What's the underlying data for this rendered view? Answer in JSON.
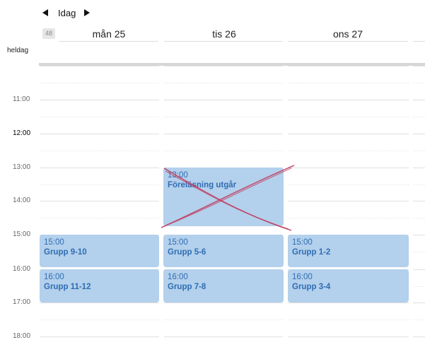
{
  "nav": {
    "today_label": "Idag"
  },
  "week_number": "48",
  "days": [
    "mån 25",
    "tis 26",
    "ons 27"
  ],
  "allday_label": "heldag",
  "times": [
    "11:00",
    "12:00",
    "13:00",
    "14:00",
    "15:00",
    "16:00",
    "17:00",
    "18:00"
  ],
  "current_hour": "12:00",
  "events": [
    {
      "time": "13:00",
      "title": "Föreläsning utgår",
      "cancelled": true
    },
    {
      "time": "15:00",
      "title": "Grupp 9-10"
    },
    {
      "time": "16:00",
      "title": "Grupp 11-12"
    },
    {
      "time": "15:00",
      "title": "Grupp 5-6"
    },
    {
      "time": "16:00",
      "title": "Grupp 7-8"
    },
    {
      "time": "15:00",
      "title": "Grupp 1-2"
    },
    {
      "time": "16:00",
      "title": "Grupp 3-4"
    }
  ],
  "colors": {
    "event_bg": "#b3d0ec",
    "event_text": "#2f6db3",
    "cancel_mark": "#c0395c"
  }
}
